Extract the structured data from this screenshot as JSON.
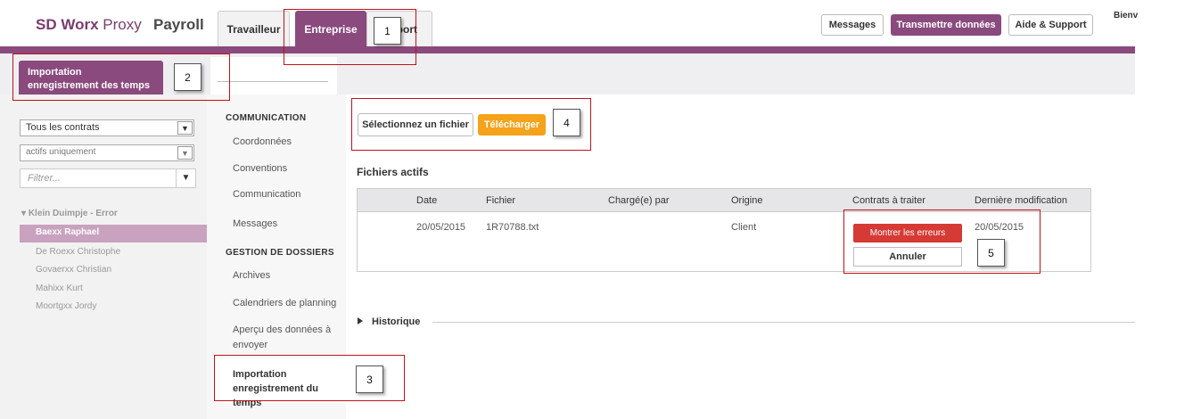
{
  "header": {
    "brand_bold": "SD Worx",
    "brand_light": " Proxy",
    "product": "Payroll",
    "tabs": [
      {
        "label": "Travailleur"
      },
      {
        "label": "Entreprise"
      },
      {
        "label": "port"
      }
    ],
    "buttons": {
      "messages": "Messages",
      "transmit": "Transmettre données",
      "help": "Aide & Support"
    },
    "greeting": "Bienv"
  },
  "page_title": "Importation enregistrement des temps",
  "sidebar": {
    "contract_select": "Tous les contrats",
    "active_select": "actifs uniquement",
    "filter_placeholder": "Filtrer...",
    "group_label": "Klein Duimpje - Error",
    "employees": [
      "Baexx Raphael",
      "De Roexx Christophe",
      "Govaerxx Christian",
      "Mahixx Kurt",
      "Moortgxx Jordy"
    ]
  },
  "nav": {
    "section1": "COMMUNICATION",
    "items1": [
      "Coordonnées",
      "Conventions",
      "Communication",
      "Messages"
    ],
    "section2": "GESTION DE DOSSIERS",
    "items2": [
      "Archives",
      "Calendriers de planning"
    ],
    "apercu_line1": "Aperçu des données à",
    "apercu_line2": "envoyer",
    "active_line1": "Importation",
    "active_line2": "enregistrement du temps"
  },
  "main": {
    "select_file": "Sélectionnez un fichier",
    "upload": "Télécharger",
    "active_files_title": "Fichiers actifs",
    "columns": [
      "Date",
      "Fichier",
      "Chargé(e) par",
      "Origine",
      "Contrats à traiter",
      "Dernière modification"
    ],
    "row": {
      "date": "20/05/2015",
      "file": "1R70788.txt",
      "uploaded_by": "",
      "origin": "Client",
      "modified": "20/05/2015"
    },
    "show_errors": "Montrer les erreurs",
    "cancel": "Annuler",
    "history": "Historique"
  },
  "annotations": [
    "1",
    "2",
    "3",
    "4",
    "5"
  ],
  "colors": {
    "brand": "#8a4a7d",
    "accent_orange": "#f5a31a",
    "error_red": "#d63a35",
    "annotation_red": "#c0121b"
  }
}
